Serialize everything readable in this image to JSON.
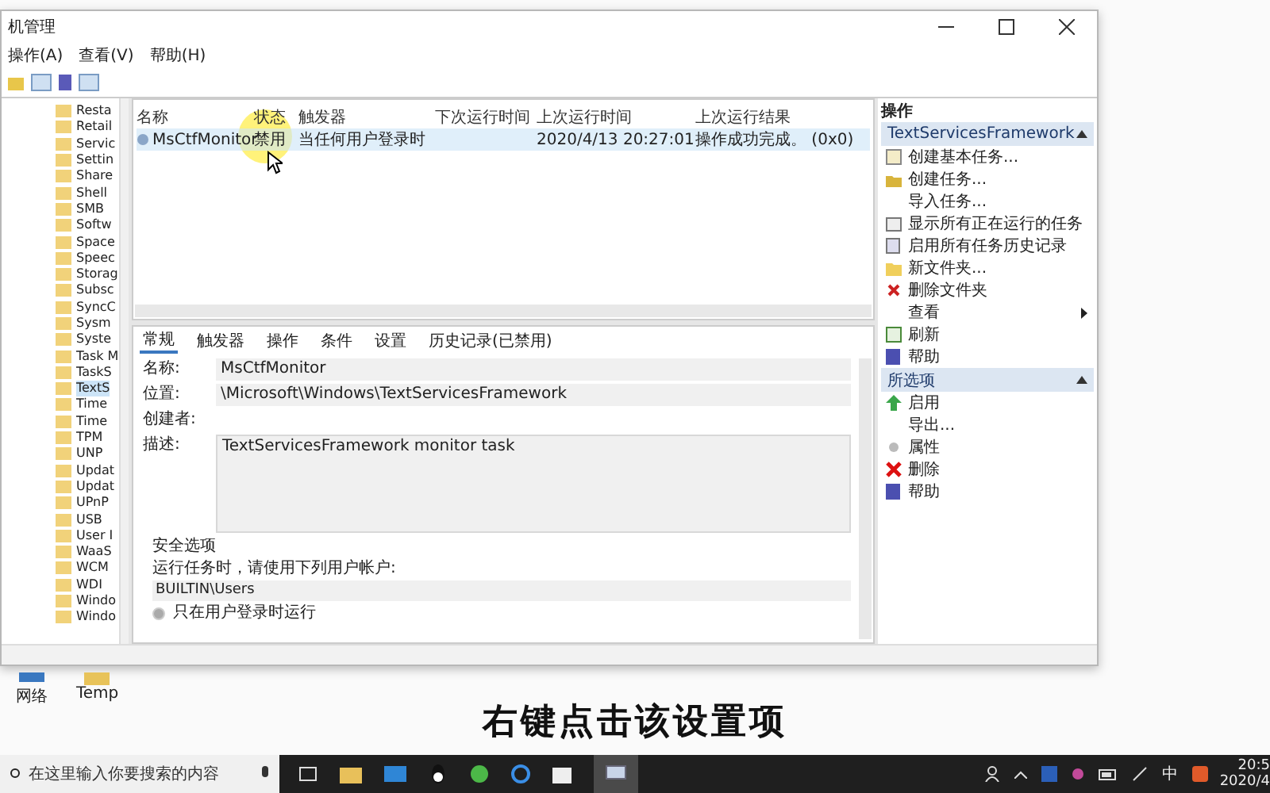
{
  "window": {
    "title": "机管理",
    "menu": [
      "操作(A)",
      "查看(V)",
      "帮助(H)"
    ]
  },
  "tree": {
    "items": [
      {
        "label": "Resta",
        "selected": false
      },
      {
        "label": "Retail",
        "selected": false
      },
      {
        "label": "Servic",
        "selected": false
      },
      {
        "label": "Settin",
        "selected": false
      },
      {
        "label": "Share",
        "selected": false
      },
      {
        "label": "Shell",
        "selected": false
      },
      {
        "label": "SMB",
        "selected": false
      },
      {
        "label": "Softw",
        "selected": false
      },
      {
        "label": "Space",
        "selected": false
      },
      {
        "label": "Speec",
        "selected": false
      },
      {
        "label": "Storag",
        "selected": false
      },
      {
        "label": "Subsc",
        "selected": false
      },
      {
        "label": "SyncC",
        "selected": false
      },
      {
        "label": "Sysm",
        "selected": false
      },
      {
        "label": "Syste",
        "selected": false
      },
      {
        "label": "Task M",
        "selected": false
      },
      {
        "label": "TaskS",
        "selected": false
      },
      {
        "label": "TextS",
        "selected": true
      },
      {
        "label": "Time",
        "selected": false
      },
      {
        "label": "Time",
        "selected": false
      },
      {
        "label": "TPM",
        "selected": false
      },
      {
        "label": "UNP",
        "selected": false
      },
      {
        "label": "Updat",
        "selected": false
      },
      {
        "label": "Updat",
        "selected": false
      },
      {
        "label": "UPnP",
        "selected": false
      },
      {
        "label": "USB",
        "selected": false
      },
      {
        "label": "User I",
        "selected": false
      },
      {
        "label": "WaaS",
        "selected": false
      },
      {
        "label": "WCM",
        "selected": false
      },
      {
        "label": "WDI",
        "selected": false
      },
      {
        "label": "Windo",
        "selected": false
      },
      {
        "label": "Windo",
        "selected": false
      }
    ]
  },
  "task_list": {
    "columns": [
      "名称",
      "状态",
      "触发器",
      "下次运行时间",
      "上次运行时间",
      "上次运行结果"
    ],
    "rows": [
      {
        "cells": [
          "MsCtfMonitor",
          "禁用",
          "当任何用户登录时",
          "",
          "2020/4/13 20:27:01",
          "操作成功完成。 (0x0)"
        ],
        "selected": true
      }
    ]
  },
  "details": {
    "tabs": [
      {
        "label": "常规",
        "selected": true
      },
      {
        "label": "触发器",
        "selected": false
      },
      {
        "label": "操作",
        "selected": false
      },
      {
        "label": "条件",
        "selected": false
      },
      {
        "label": "设置",
        "selected": false
      },
      {
        "label": "历史记录(已禁用)",
        "selected": false
      }
    ],
    "fields": [
      {
        "label": "名称:",
        "value": "MsCtfMonitor",
        "kind": "line"
      },
      {
        "label": "位置:",
        "value": "\\Microsoft\\Windows\\TextServicesFramework",
        "kind": "line"
      },
      {
        "label": "创建者:",
        "kind": "plain"
      },
      {
        "label": "描述:",
        "value": "TextServicesFramework monitor task",
        "kind": "area"
      }
    ],
    "security": {
      "heading": "安全选项",
      "run_as_label": "运行任务时，请使用下列用户帐户:",
      "account": "BUILTIN\\Users",
      "options": [
        {
          "label": "只在用户登录时运行",
          "selected": true
        }
      ]
    }
  },
  "actions": {
    "title": "操作",
    "sections": [
      {
        "title": "TextServicesFramework",
        "items": [
          {
            "label": "创建基本任务...",
            "submenu": false
          },
          {
            "label": "创建任务...",
            "submenu": false
          },
          {
            "label": "导入任务...",
            "submenu": false
          },
          {
            "label": "显示所有正在运行的任务",
            "submenu": false
          },
          {
            "label": "启用所有任务历史记录",
            "submenu": false
          },
          {
            "label": "新文件夹...",
            "submenu": false
          },
          {
            "label": "删除文件夹",
            "submenu": false
          },
          {
            "label": "查看",
            "submenu": true
          },
          {
            "label": "刷新",
            "submenu": false
          },
          {
            "label": "帮助",
            "submenu": false
          }
        ]
      },
      {
        "title": "所选项",
        "items": [
          {
            "label": "启用",
            "submenu": false
          },
          {
            "label": "导出...",
            "submenu": false
          },
          {
            "label": "属性",
            "submenu": false
          },
          {
            "label": "删除",
            "submenu": false
          },
          {
            "label": "帮助",
            "submenu": false
          }
        ]
      }
    ]
  },
  "desktop_icons": [
    "网络",
    "Temp"
  ],
  "caption": "右键点击该设置项",
  "taskbar": {
    "search": {
      "placeholder": "在这里输入你要搜索的内容"
    },
    "ime": "中",
    "time": "20:5",
    "date": "2020/4"
  }
}
